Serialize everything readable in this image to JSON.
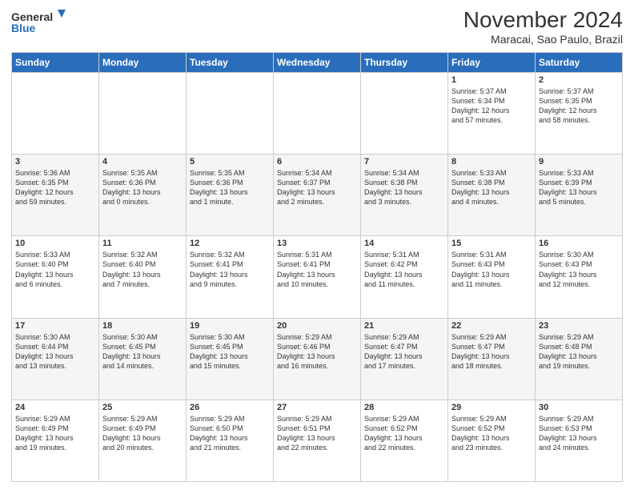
{
  "logo": {
    "line1": "General",
    "line2": "Blue"
  },
  "title": "November 2024",
  "subtitle": "Maracai, Sao Paulo, Brazil",
  "weekdays": [
    "Sunday",
    "Monday",
    "Tuesday",
    "Wednesday",
    "Thursday",
    "Friday",
    "Saturday"
  ],
  "weeks": [
    [
      {
        "day": "",
        "info": ""
      },
      {
        "day": "",
        "info": ""
      },
      {
        "day": "",
        "info": ""
      },
      {
        "day": "",
        "info": ""
      },
      {
        "day": "",
        "info": ""
      },
      {
        "day": "1",
        "info": "Sunrise: 5:37 AM\nSunset: 6:34 PM\nDaylight: 12 hours\nand 57 minutes."
      },
      {
        "day": "2",
        "info": "Sunrise: 5:37 AM\nSunset: 6:35 PM\nDaylight: 12 hours\nand 58 minutes."
      }
    ],
    [
      {
        "day": "3",
        "info": "Sunrise: 5:36 AM\nSunset: 6:35 PM\nDaylight: 12 hours\nand 59 minutes."
      },
      {
        "day": "4",
        "info": "Sunrise: 5:35 AM\nSunset: 6:36 PM\nDaylight: 13 hours\nand 0 minutes."
      },
      {
        "day": "5",
        "info": "Sunrise: 5:35 AM\nSunset: 6:36 PM\nDaylight: 13 hours\nand 1 minute."
      },
      {
        "day": "6",
        "info": "Sunrise: 5:34 AM\nSunset: 6:37 PM\nDaylight: 13 hours\nand 2 minutes."
      },
      {
        "day": "7",
        "info": "Sunrise: 5:34 AM\nSunset: 6:38 PM\nDaylight: 13 hours\nand 3 minutes."
      },
      {
        "day": "8",
        "info": "Sunrise: 5:33 AM\nSunset: 6:38 PM\nDaylight: 13 hours\nand 4 minutes."
      },
      {
        "day": "9",
        "info": "Sunrise: 5:33 AM\nSunset: 6:39 PM\nDaylight: 13 hours\nand 5 minutes."
      }
    ],
    [
      {
        "day": "10",
        "info": "Sunrise: 5:33 AM\nSunset: 6:40 PM\nDaylight: 13 hours\nand 6 minutes."
      },
      {
        "day": "11",
        "info": "Sunrise: 5:32 AM\nSunset: 6:40 PM\nDaylight: 13 hours\nand 7 minutes."
      },
      {
        "day": "12",
        "info": "Sunrise: 5:32 AM\nSunset: 6:41 PM\nDaylight: 13 hours\nand 9 minutes."
      },
      {
        "day": "13",
        "info": "Sunrise: 5:31 AM\nSunset: 6:41 PM\nDaylight: 13 hours\nand 10 minutes."
      },
      {
        "day": "14",
        "info": "Sunrise: 5:31 AM\nSunset: 6:42 PM\nDaylight: 13 hours\nand 11 minutes."
      },
      {
        "day": "15",
        "info": "Sunrise: 5:31 AM\nSunset: 6:43 PM\nDaylight: 13 hours\nand 11 minutes."
      },
      {
        "day": "16",
        "info": "Sunrise: 5:30 AM\nSunset: 6:43 PM\nDaylight: 13 hours\nand 12 minutes."
      }
    ],
    [
      {
        "day": "17",
        "info": "Sunrise: 5:30 AM\nSunset: 6:44 PM\nDaylight: 13 hours\nand 13 minutes."
      },
      {
        "day": "18",
        "info": "Sunrise: 5:30 AM\nSunset: 6:45 PM\nDaylight: 13 hours\nand 14 minutes."
      },
      {
        "day": "19",
        "info": "Sunrise: 5:30 AM\nSunset: 6:45 PM\nDaylight: 13 hours\nand 15 minutes."
      },
      {
        "day": "20",
        "info": "Sunrise: 5:29 AM\nSunset: 6:46 PM\nDaylight: 13 hours\nand 16 minutes."
      },
      {
        "day": "21",
        "info": "Sunrise: 5:29 AM\nSunset: 6:47 PM\nDaylight: 13 hours\nand 17 minutes."
      },
      {
        "day": "22",
        "info": "Sunrise: 5:29 AM\nSunset: 6:47 PM\nDaylight: 13 hours\nand 18 minutes."
      },
      {
        "day": "23",
        "info": "Sunrise: 5:29 AM\nSunset: 6:48 PM\nDaylight: 13 hours\nand 19 minutes."
      }
    ],
    [
      {
        "day": "24",
        "info": "Sunrise: 5:29 AM\nSunset: 6:49 PM\nDaylight: 13 hours\nand 19 minutes."
      },
      {
        "day": "25",
        "info": "Sunrise: 5:29 AM\nSunset: 6:49 PM\nDaylight: 13 hours\nand 20 minutes."
      },
      {
        "day": "26",
        "info": "Sunrise: 5:29 AM\nSunset: 6:50 PM\nDaylight: 13 hours\nand 21 minutes."
      },
      {
        "day": "27",
        "info": "Sunrise: 5:29 AM\nSunset: 6:51 PM\nDaylight: 13 hours\nand 22 minutes."
      },
      {
        "day": "28",
        "info": "Sunrise: 5:29 AM\nSunset: 6:52 PM\nDaylight: 13 hours\nand 22 minutes."
      },
      {
        "day": "29",
        "info": "Sunrise: 5:29 AM\nSunset: 6:52 PM\nDaylight: 13 hours\nand 23 minutes."
      },
      {
        "day": "30",
        "info": "Sunrise: 5:29 AM\nSunset: 6:53 PM\nDaylight: 13 hours\nand 24 minutes."
      }
    ]
  ]
}
